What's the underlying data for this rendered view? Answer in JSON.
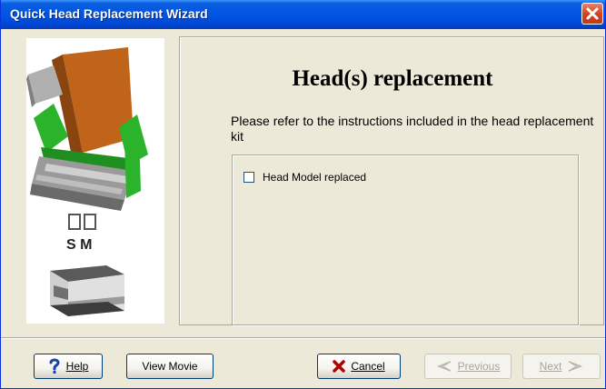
{
  "window": {
    "title": "Quick Head Replacement Wizard",
    "close_icon": "close-icon"
  },
  "sidebar": {
    "mode_letters": "S M"
  },
  "main": {
    "heading": "Head(s) replacement",
    "instructions": "Please refer to the instructions included in the head replacement kit",
    "checkbox": {
      "label": "Head Model replaced",
      "checked": false
    }
  },
  "buttons": {
    "help": {
      "label": "Help",
      "icon": "help-icon"
    },
    "view_movie": {
      "label": "View Movie"
    },
    "cancel": {
      "label": "Cancel",
      "icon": "cancel-x-icon"
    },
    "previous": {
      "label": "Previous",
      "icon": "previous-arrow-icon",
      "enabled": false
    },
    "next": {
      "label": "Next",
      "icon": "next-arrow-icon",
      "enabled": false
    }
  },
  "colors": {
    "titlebar": "#0055e5",
    "window_bg": "#ece9d8",
    "close": "#d2451f",
    "cancel_icon": "#b00000",
    "help_icon": "#1a3fb0",
    "printhead_green": "#2bb32b",
    "ribbon_orange": "#c0641a"
  }
}
